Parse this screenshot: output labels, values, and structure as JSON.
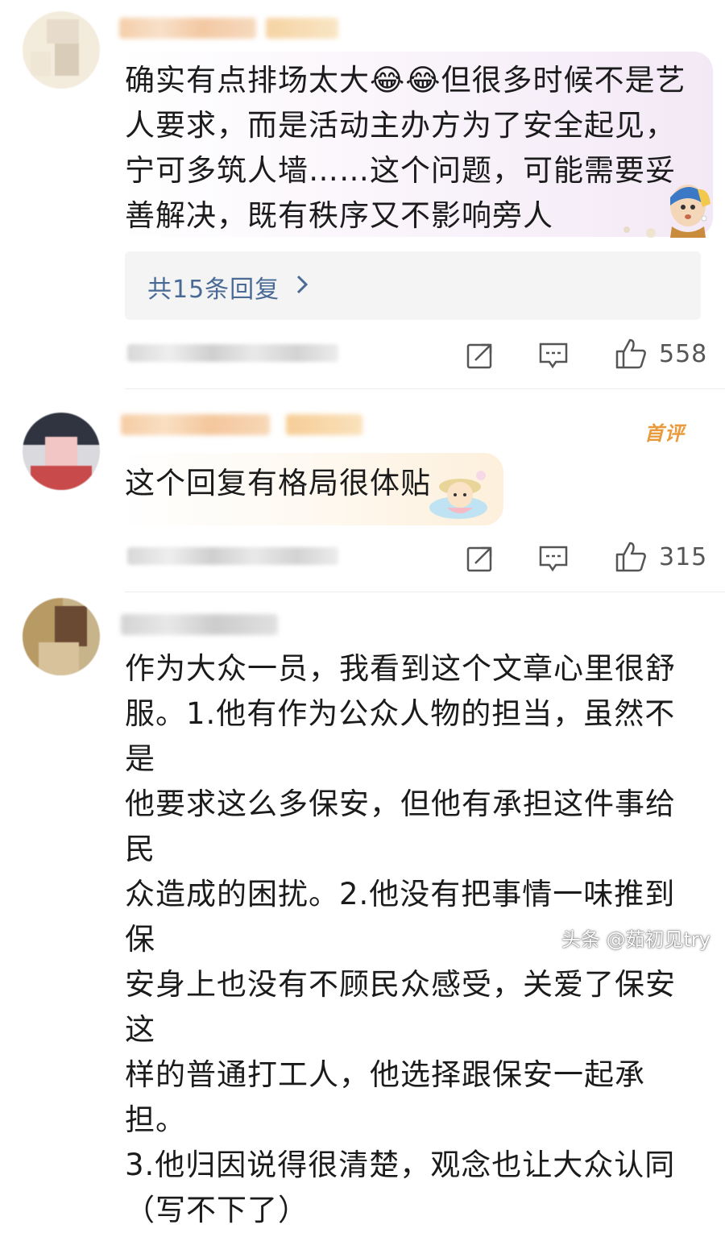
{
  "comments": [
    {
      "text": "确实有点排场太大😂😂但很多时候不是艺\n人要求，而是活动主办方为了安全起见，\n宁可多筑人墙……这个问题，可能需要妥\n善解决，既有秩序又不影响旁人",
      "replies_label": "共15条回复",
      "likes": "558",
      "icons": [
        "repost-icon",
        "comment-icon",
        "like-icon",
        "chevron-right-icon"
      ]
    },
    {
      "badge": "首评",
      "text": "这个回复有格局很体贴",
      "likes": "315",
      "icons": [
        "repost-icon",
        "comment-icon",
        "like-icon"
      ]
    },
    {
      "text": "作为大众一员，我看到这个文章心里很舒\n服。1.他有作为公众人物的担当，虽然不是\n他要求这么多保安，但他有承担这件事给民\n众造成的困扰。2.他没有把事情一味推到保\n安身上也没有不顾民众感受，关爱了保安这\n样的普通打工人，他选择跟保安一起承担。\n3.他归因说得很清楚，观念也让大众认同\n（写不下了）"
    }
  ],
  "watermark": "头条 @茹初见try",
  "colors": {
    "link": "#4a6a96",
    "badge": "#e89a3c",
    "bubble1": "#f7eef8",
    "bubble2": "#fdf3e3"
  }
}
